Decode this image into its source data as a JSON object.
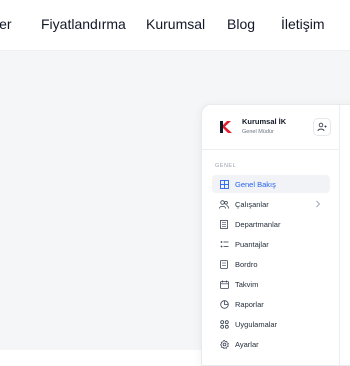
{
  "nav": {
    "items": [
      "ler",
      "Fiyatlandırma",
      "Kurumsal",
      "Blog",
      "İletişim"
    ]
  },
  "profile": {
    "company": "Kurumsal İK",
    "role": "Genel Müdür",
    "user_icon": "user-switch-icon"
  },
  "sidebar": {
    "section": "GENEL",
    "items": [
      {
        "label": "Genel Bakış",
        "icon": "grid-icon",
        "active": true
      },
      {
        "label": "Çalışanlar",
        "icon": "users-icon",
        "has_submenu": true
      },
      {
        "label": "Departmanlar",
        "icon": "building-icon"
      },
      {
        "label": "Puantajlar",
        "icon": "timesheet-icon"
      },
      {
        "label": "Bordro",
        "icon": "payroll-icon"
      },
      {
        "label": "Takvim",
        "icon": "calendar-icon"
      },
      {
        "label": "Raporlar",
        "icon": "pie-chart-icon"
      },
      {
        "label": "Uygulamalar",
        "icon": "apps-icon"
      },
      {
        "label": "Ayarlar",
        "icon": "gear-icon"
      }
    ]
  },
  "colors": {
    "accent": "#2563eb",
    "brand_red": "#e11d2e",
    "hero_bg": "#f5f6f7"
  }
}
